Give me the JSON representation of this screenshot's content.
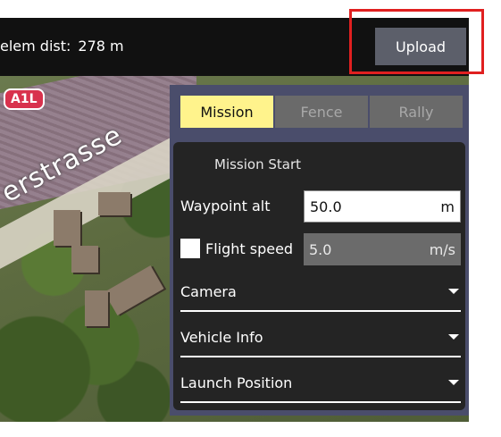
{
  "toolbar": {
    "telem_label": "elem dist:",
    "telem_value": "278 m",
    "upload_label": "Upload"
  },
  "map": {
    "route_badge": "A1L",
    "street_label": "erstrasse"
  },
  "tabs": [
    {
      "label": "Mission",
      "active": true
    },
    {
      "label": "Fence",
      "active": false
    },
    {
      "label": "Rally",
      "active": false
    }
  ],
  "mission_start": {
    "title": "Mission Start",
    "waypoint_alt": {
      "label": "Waypoint alt",
      "value": "50.0",
      "unit": "m"
    },
    "flight_speed": {
      "label": "Flight speed",
      "value": "5.0",
      "unit": "m/s",
      "checked": false
    },
    "sections": [
      {
        "label": "Camera"
      },
      {
        "label": "Vehicle Info"
      },
      {
        "label": "Launch Position"
      }
    ]
  },
  "colors": {
    "accent_tab": "#fff38c",
    "panel_bg": "#4a4d6b",
    "highlight": "#e02020"
  }
}
